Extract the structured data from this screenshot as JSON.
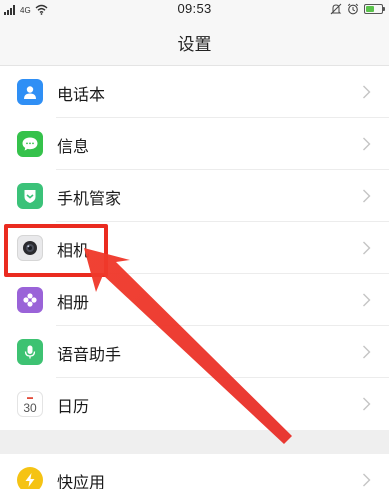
{
  "status_bar": {
    "time": "09:53",
    "signal_label": "4G",
    "battery_level": 0.55,
    "icons": [
      "signal-icon",
      "wifi-icon",
      "vibrate-icon",
      "alarm-icon",
      "battery-icon"
    ]
  },
  "header": {
    "title": "设置"
  },
  "settings": {
    "items": [
      {
        "label": "电话本",
        "icon": "contacts-icon",
        "color": "#2f8ff5"
      },
      {
        "label": "信息",
        "icon": "message-icon",
        "color": "#35c24b"
      },
      {
        "label": "手机管家",
        "icon": "phone-manager-icon",
        "color": "#3bc279"
      },
      {
        "label": "相机",
        "icon": "camera-icon",
        "color": "#e9e9eb"
      },
      {
        "label": "相册",
        "icon": "album-icon",
        "color": "#9a63d8"
      },
      {
        "label": "语音助手",
        "icon": "voice-assistant-icon",
        "color": "#3dc272"
      },
      {
        "label": "日历",
        "icon": "calendar-icon",
        "color": "#ffffff"
      }
    ],
    "second_group": [
      {
        "label": "快应用",
        "icon": "quick-app-icon",
        "color": "#f5c314"
      }
    ],
    "calendar_day": "30"
  },
  "annotation": {
    "color": "#ea2b20",
    "target": "相机"
  }
}
